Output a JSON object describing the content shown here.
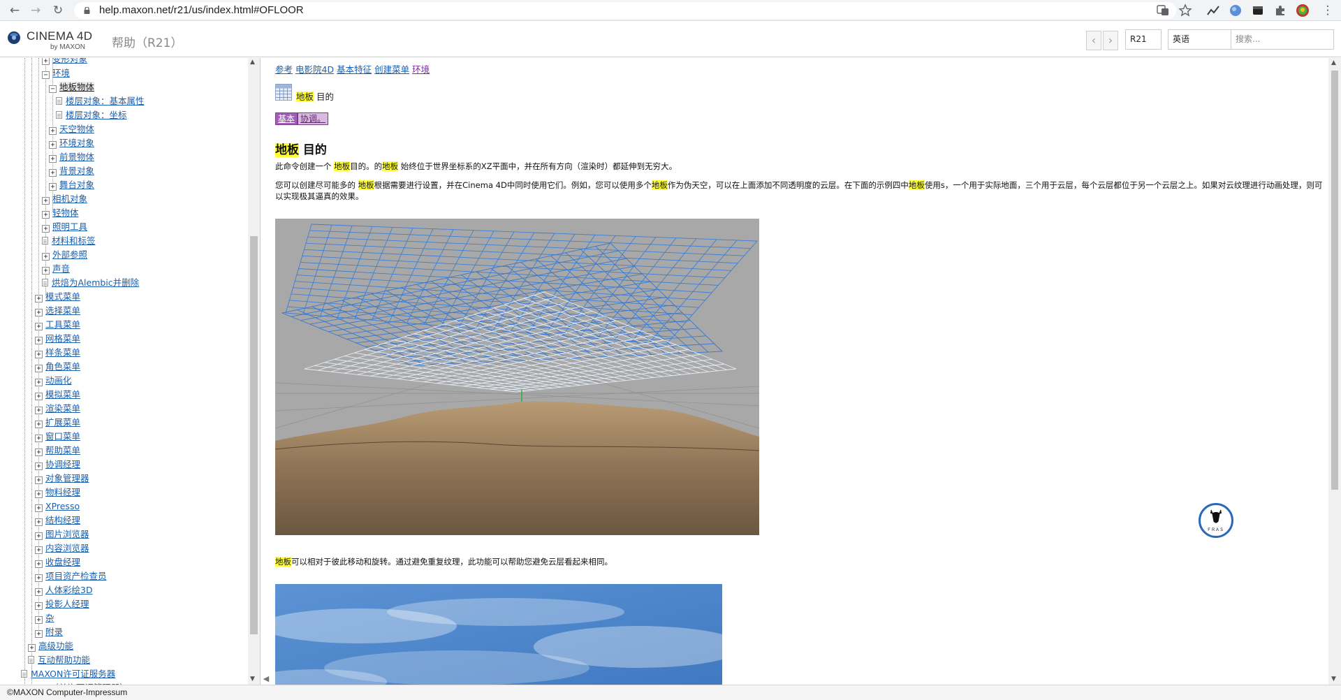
{
  "browser": {
    "url": "help.maxon.net/r21/us/index.html#OFLOOR"
  },
  "header": {
    "logo_text": "CINEMA 4D",
    "logo_sub": "by MAXON",
    "title": "帮助（R21）",
    "prev_icon": "chevron-left-icon",
    "next_icon": "chevron-right-icon",
    "version_value": "R21",
    "language_value": "英语",
    "search_placeholder": "搜索..."
  },
  "sidebar": {
    "items": [
      {
        "label": "变形对象",
        "level": 5,
        "expander": "plus",
        "cut": true
      },
      {
        "label": "环境",
        "level": 5,
        "expander": "minus"
      },
      {
        "label": "地板物体",
        "level": 6,
        "expander": "minus",
        "current": true
      },
      {
        "label": "楼层对象：基本属性",
        "level": 7,
        "expander": "doc"
      },
      {
        "label": "楼层对象：坐标",
        "level": 7,
        "expander": "doc"
      },
      {
        "label": "天空物体",
        "level": 6,
        "expander": "plus"
      },
      {
        "label": "环境对象",
        "level": 6,
        "expander": "plus"
      },
      {
        "label": "前景物体",
        "level": 6,
        "expander": "plus"
      },
      {
        "label": "背景对象",
        "level": 6,
        "expander": "plus"
      },
      {
        "label": "舞台对象",
        "level": 6,
        "expander": "plus"
      },
      {
        "label": "相机对象",
        "level": 5,
        "expander": "plus"
      },
      {
        "label": "轻物体",
        "level": 5,
        "expander": "plus"
      },
      {
        "label": "照明工具",
        "level": 5,
        "expander": "plus"
      },
      {
        "label": "材料和标签",
        "level": 5,
        "expander": "doc"
      },
      {
        "label": "外部参照",
        "level": 5,
        "expander": "plus"
      },
      {
        "label": "声音",
        "level": 5,
        "expander": "plus"
      },
      {
        "label": "烘焙为Alembic并删除",
        "level": 5,
        "expander": "doc"
      },
      {
        "label": "模式菜单",
        "level": 4,
        "expander": "plus"
      },
      {
        "label": "选择菜单",
        "level": 4,
        "expander": "plus"
      },
      {
        "label": "工具菜单",
        "level": 4,
        "expander": "plus"
      },
      {
        "label": "网格菜单",
        "level": 4,
        "expander": "plus"
      },
      {
        "label": "样条菜单",
        "level": 4,
        "expander": "plus"
      },
      {
        "label": "角色菜单",
        "level": 4,
        "expander": "plus"
      },
      {
        "label": "动画化",
        "level": 4,
        "expander": "plus"
      },
      {
        "label": "模拟菜单",
        "level": 4,
        "expander": "plus"
      },
      {
        "label": "渲染菜单",
        "level": 4,
        "expander": "plus"
      },
      {
        "label": "扩展菜单",
        "level": 4,
        "expander": "plus"
      },
      {
        "label": "窗口菜单",
        "level": 4,
        "expander": "plus"
      },
      {
        "label": "帮助菜单",
        "level": 4,
        "expander": "plus"
      },
      {
        "label": "协调经理",
        "level": 4,
        "expander": "plus"
      },
      {
        "label": "对象管理器",
        "level": 4,
        "expander": "plus"
      },
      {
        "label": "物料经理",
        "level": 4,
        "expander": "plus"
      },
      {
        "label": "XPresso",
        "level": 4,
        "expander": "plus"
      },
      {
        "label": "结构经理",
        "level": 4,
        "expander": "plus"
      },
      {
        "label": "图片浏览器",
        "level": 4,
        "expander": "plus"
      },
      {
        "label": "内容浏览器",
        "level": 4,
        "expander": "plus"
      },
      {
        "label": "收盘经理",
        "level": 4,
        "expander": "plus"
      },
      {
        "label": "项目资产检查员",
        "level": 4,
        "expander": "plus"
      },
      {
        "label": "人体彩绘3D",
        "level": 4,
        "expander": "plus"
      },
      {
        "label": "投影人经理",
        "level": 4,
        "expander": "plus"
      },
      {
        "label": "杂",
        "level": 4,
        "expander": "plus"
      },
      {
        "label": "附录",
        "level": 4,
        "expander": "plus"
      },
      {
        "label": "高级功能",
        "level": 3,
        "expander": "plus"
      },
      {
        "label": "互动帮助功能",
        "level": 3,
        "expander": "doc"
      },
      {
        "label": "MAXON许可证服务器",
        "level": 2,
        "expander": "doc"
      },
      {
        "label": "RLM（单许可证管理器）",
        "level": 2,
        "expander": "plus",
        "cut": true
      }
    ]
  },
  "content": {
    "breadcrumb": [
      {
        "label": "参考",
        "visited": false
      },
      {
        "label": "电影院4D",
        "visited": false
      },
      {
        "label": "基本特征",
        "visited": false
      },
      {
        "label": "创建菜单",
        "visited": false
      },
      {
        "label": "环境",
        "visited": true
      }
    ],
    "object_caption_hl": "地板",
    "object_caption_rest": "目的",
    "tabs": [
      {
        "label": "基本",
        "active": true
      },
      {
        "label": "协调。",
        "active": false
      }
    ],
    "section_title_hl": "地板",
    "section_title_rest": "目的",
    "para1": [
      {
        "t": "此命令创建一个 ",
        "hl": false
      },
      {
        "t": "地板",
        "hl": true
      },
      {
        "t": "目的。的",
        "hl": false
      },
      {
        "t": "地板",
        "hl": true
      },
      {
        "t": " 始终位于世界坐标系的XZ平面中，并在所有方向（渲染时）都延伸到无穷大。",
        "hl": false
      }
    ],
    "para2": [
      {
        "t": "您可以创建尽可能多的 ",
        "hl": false
      },
      {
        "t": "地板",
        "hl": true
      },
      {
        "t": "根据需要进行设置，并在Cinema 4D中同时使用它们。例如，您可以使用多个",
        "hl": false
      },
      {
        "t": "地板",
        "hl": true
      },
      {
        "t": "作为伪天空，可以在上面添加不同透明度的云层。在下面的示例四中",
        "hl": false
      },
      {
        "t": "地板",
        "hl": true
      },
      {
        "t": "使用s，一个用于实际地面，三个用于云层，每个云层都位于另一个云层之上。如果对云纹理进行动画处理，则可以实现极其逼真的效果。",
        "hl": false
      }
    ],
    "para3": [
      {
        "t": "地板",
        "hl": true
      },
      {
        "t": "可以相对于彼此移动和旋转。通过避免重复纹理，此功能可以帮助您避免云层看起来相同。",
        "hl": false
      }
    ],
    "badge_text": "ＦＲＡＳ"
  },
  "footer": {
    "text": "©MAXON Computer-Impressum"
  },
  "colors": {
    "link": "#1a5fb0",
    "visited": "#7b2b9a",
    "highlight": "#ffff33",
    "tab_active": "#a05eb5"
  }
}
